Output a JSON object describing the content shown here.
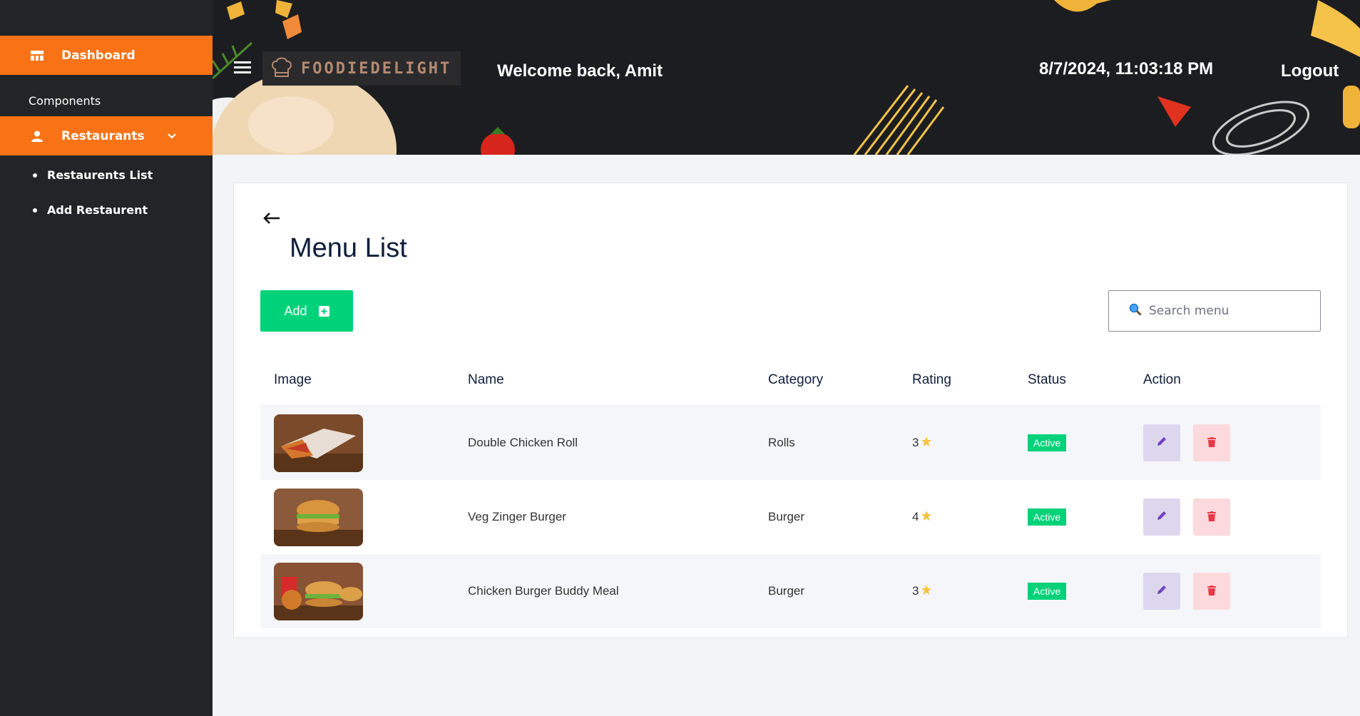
{
  "sidebar": {
    "dashboard_label": "Dashboard",
    "section_label": "Components",
    "restaurants_label": "Restaurants",
    "sub_items": [
      {
        "label": "Restaurents List"
      },
      {
        "label": "Add Restaurent"
      }
    ]
  },
  "header": {
    "brand": "FOODIEDELIGHT",
    "welcome": "Welcome back, Amit",
    "datetime": "8/7/2024, 11:03:18 PM",
    "logout": "Logout"
  },
  "main": {
    "title": "Menu List",
    "add_label": "Add",
    "search_placeholder": "Search menu",
    "columns": [
      "Image",
      "Name",
      "Category",
      "Rating",
      "Status",
      "Action"
    ],
    "rows": [
      {
        "name": "Double Chicken Roll",
        "category": "Rolls",
        "rating": "3",
        "status": "Active",
        "image": "chicken-roll-photo"
      },
      {
        "name": "Veg Zinger Burger",
        "category": "Burger",
        "rating": "4",
        "status": "Active",
        "image": "veg-burger-photo"
      },
      {
        "name": "Chicken Burger Buddy Meal",
        "category": "Burger",
        "rating": "3",
        "status": "Active",
        "image": "burger-meal-photo"
      }
    ]
  },
  "colors": {
    "accent": "#f97316",
    "sidebar_bg": "#232427",
    "success": "#00d27a",
    "title": "#0f1e3a"
  },
  "icons": [
    "dashboard-icon",
    "user-icon",
    "chevron-down-icon",
    "hamburger-icon",
    "chef-hat-icon",
    "back-arrow-icon",
    "plus-square-icon",
    "search-icon",
    "star-icon",
    "edit-icon",
    "trash-icon"
  ]
}
